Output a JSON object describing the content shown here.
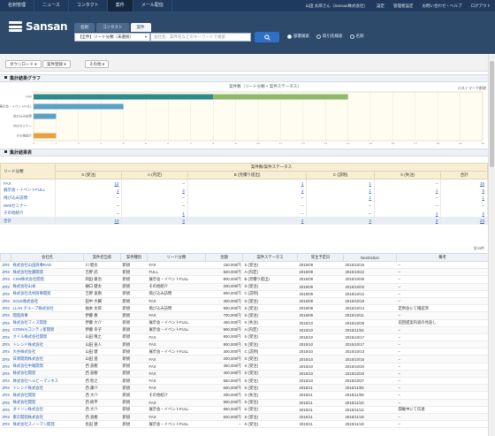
{
  "topnav": {
    "items": [
      "名刺管理",
      "ニュース",
      "コンタクト",
      "案件",
      "メール配信"
    ],
    "active_index": 3,
    "right_links": [
      "山田 太郎さん（Sansan株式会社）",
      "設定",
      "管理者設定",
      "お問い合わせ・ヘルプ",
      "ログアウト"
    ]
  },
  "brand": {
    "name": "Sansan"
  },
  "search": {
    "tabs": [
      "名刺",
      "コンタクト",
      "案件"
    ],
    "active_tab": 2,
    "select_value": "【全件】リード分類（未選択）",
    "placeholder": "会社名、案件名などのキーワードで検索",
    "radios": [
      "部署検索",
      "取引先検索",
      "名刺"
    ]
  },
  "toolbar": {
    "buttons": [
      "ダウンロード",
      "案件登録",
      "その他"
    ]
  },
  "chart_section": {
    "title": "集計結果グラフ"
  },
  "chart_data": {
    "type": "bar",
    "title": "案件数（リード分類 × 案件ステータス）",
    "legend_label": "ロストマーク削除",
    "categories": [
      "FAX",
      "展示会・イベントFULL",
      "飛び込み訪問",
      "Webセミナー",
      "その他紹介"
    ],
    "series": [
      {
        "name": "S",
        "color": "#2e8b8b",
        "values": [
          8,
          0,
          0,
          0,
          0
        ]
      },
      {
        "name": "A",
        "color": "#8fb86a",
        "values": [
          6,
          0,
          0,
          0,
          0
        ]
      },
      {
        "name": "B",
        "color": "#5aa0c8",
        "values": [
          0,
          4,
          1,
          0,
          0
        ]
      },
      {
        "name": "C",
        "color": "#e8a040",
        "values": [
          0,
          0,
          0,
          0,
          1
        ]
      }
    ],
    "xlim": [
      0,
      20
    ],
    "xticks": [
      0,
      1,
      2,
      3,
      4,
      5,
      6,
      7,
      8,
      9,
      10,
      11,
      12,
      13,
      14,
      15,
      16,
      17,
      18,
      19,
      20
    ]
  },
  "summary_section": {
    "title": "集計結果表"
  },
  "summary_table": {
    "group_header": "案件数/案件ステータス",
    "row_header": "リード分類",
    "columns": [
      "S (受注)",
      "A (内定)",
      "B (見積り提出)",
      "C (説明)",
      "X (失注)",
      "合計"
    ],
    "rows": [
      {
        "label": "FAX",
        "values": [
          "12",
          "–",
          "1",
          "1",
          "–",
          "15"
        ]
      },
      {
        "label": "展示会・イベントFULL",
        "values": [
          "1",
          "2",
          "1",
          "1",
          "1",
          "5"
        ]
      },
      {
        "label": "飛び込み訪問",
        "values": [
          "–",
          "–",
          "–",
          "1",
          "–",
          "1"
        ]
      },
      {
        "label": "Webセミナー",
        "values": [
          "–",
          "–",
          "–",
          "–",
          "–",
          "–"
        ]
      },
      {
        "label": "その他紹介",
        "values": [
          "–",
          "1",
          "–",
          "–",
          "1",
          "2"
        ]
      }
    ],
    "total": {
      "label": "合計",
      "values": [
        "13",
        "3",
        "2",
        "3",
        "2",
        "23"
      ]
    }
  },
  "list": {
    "count_label": "全33件",
    "columns": [
      "",
      "会社名",
      "案件担当者",
      "案件種別",
      "リード分類",
      "金額",
      "案件ステータス",
      "受注予定日",
      "NextAction",
      "備考"
    ],
    "rows": [
      [
        "ZRS",
        "株式会社山田商事RAD",
        "川 健太",
        "新規",
        "FAX",
        "150,000円",
        "S (受注)",
        "2015/09",
        "2015/10/16",
        "–"
      ],
      [
        "ZRS",
        "株式会社佐藤開発",
        "吉野 武",
        "新規",
        "FULL",
        "500,000円",
        "A (内定)",
        "2015/09",
        "2015/10/22",
        "–"
      ],
      [
        "ZRS",
        "CSM株式会社開発",
        "岡田 康治",
        "新規",
        "展示会・イベントFULL",
        "800,000円",
        "B (見積り提出)",
        "2015/09",
        "2015/10/30",
        "–"
      ],
      [
        "ZRS",
        "株式会社山本",
        "樋口 健太",
        "新規",
        "その他紹介",
        "200,000円",
        "S (受注)",
        "2015/09",
        "2015/10/02",
        "–"
      ],
      [
        "ZRS",
        "株式会社北村商事開発",
        "吉野 直樹",
        "新規",
        "飛び込み訪問",
        "600,000円",
        "C (説明)",
        "2015/09",
        "2015/10/12",
        "–"
      ],
      [
        "ZRS",
        "SOLE株式会社",
        "田中 大輔",
        "新規",
        "FAX",
        "300,000円",
        "S (受注)",
        "2015/09",
        "2015/10/19",
        "–"
      ],
      [
        "ZRS",
        "LLAN グループ株式会社",
        "福本 太郎",
        "新規",
        "飛び込み訪問",
        "900,000円",
        "S (受注)",
        "2015/09",
        "2015/10/14",
        "定例会にて確認済"
      ],
      [
        "ZRS",
        "開発商事",
        "伊藤 春",
        "新規",
        "FAX",
        "700,000円",
        "S (受注)",
        "2015/09",
        "2015/10/11",
        "–"
      ],
      [
        "ZRS",
        "株式会社フィス開発",
        "伊藤 大介",
        "新規",
        "展示会・イベントFULL",
        "450,000円",
        "X (失注)",
        "2015/10",
        "2015/10/28",
        "前回提案内容の見直し"
      ],
      [
        "ZRS",
        "CONNA(コンティ新開発",
        "伊藤 幸子",
        "新規",
        "展示会・イベントFULL",
        "900,000円",
        "A (内定)",
        "2015/10",
        "2015/11/04",
        "–"
      ],
      [
        "ZRS",
        "オイル株式会社開発",
        "山田 隆之",
        "新規",
        "FAX",
        "800,000円",
        "S (受注)",
        "2015/10",
        "2015/10/17",
        "–"
      ],
      [
        "ZRS",
        "トレンド株式会社",
        "山田 直人",
        "新規",
        "FAX",
        "900,000円",
        "S (受注)",
        "2015/10",
        "2015/10/17",
        "–"
      ],
      [
        "ZRS",
        "大谷株式会社",
        "山田 健",
        "新規",
        "展示会・イベントFULL",
        "300,000円",
        "C (説明)",
        "2015/10",
        "2015/10/13",
        "–"
      ],
      [
        "ZRS",
        "日清開発株式会社",
        "山田 進",
        "新規",
        "FAX",
        "200,000円",
        "S (受注)",
        "2015/10",
        "2015/10/15",
        "–"
      ],
      [
        "ZRS",
        "株式会社中尾開発",
        "西 直樹",
        "新規",
        "FAX",
        "350,000円",
        "S (受注)",
        "2015/10",
        "2015/10/20",
        "–"
      ],
      [
        "ZRS",
        "株式会社開発",
        "西 直樹",
        "新規",
        "FAX",
        "400,000円",
        "S (受注)",
        "2015/10",
        "2015/10/20",
        "–"
      ],
      [
        "ZRS",
        "株式会社ヘルビーマンネス",
        "西 智之",
        "新規",
        "FAX",
        "550,000円",
        "S (受注)",
        "2015/10",
        "2015/10/27",
        "–"
      ],
      [
        "ZRS",
        "トレンド株式会社",
        "西 康介",
        "新規",
        "FAX",
        "600,000円",
        "S (受注)",
        "2015/11",
        "2015/11/05",
        "–"
      ],
      [
        "ZRS",
        "株式会社開発",
        "西 大介",
        "新規",
        "その他紹介",
        "200,000円",
        "X (失注)",
        "2015/11",
        "2015/11/09",
        "–"
      ],
      [
        "ZRS",
        "株式会社開発",
        "西 純平",
        "新規",
        "FAX",
        "800,000円",
        "S (受注)",
        "2015/11",
        "2015/11/10",
        "–"
      ],
      [
        "ZRS",
        "ダイソン株式会社",
        "西 大介",
        "新規",
        "展示会・イベントFULL",
        "850,000円",
        "S (受注)",
        "2015/11",
        "2015/11/12",
        "開催中にて伝達"
      ],
      [
        "ZRS",
        "東京開発株式会社",
        "西 直樹",
        "新規",
        "FAX",
        "600,000円",
        "S (受注)",
        "2015/11",
        "2015/11/18",
        "–"
      ],
      [
        "ZRS",
        "株式会社スノーマン開発",
        "長田 健",
        "新規",
        "展示会・イベントFULL",
        "–",
        "S (受注)",
        "2015/11",
        "2015/11/18",
        "–"
      ]
    ]
  }
}
